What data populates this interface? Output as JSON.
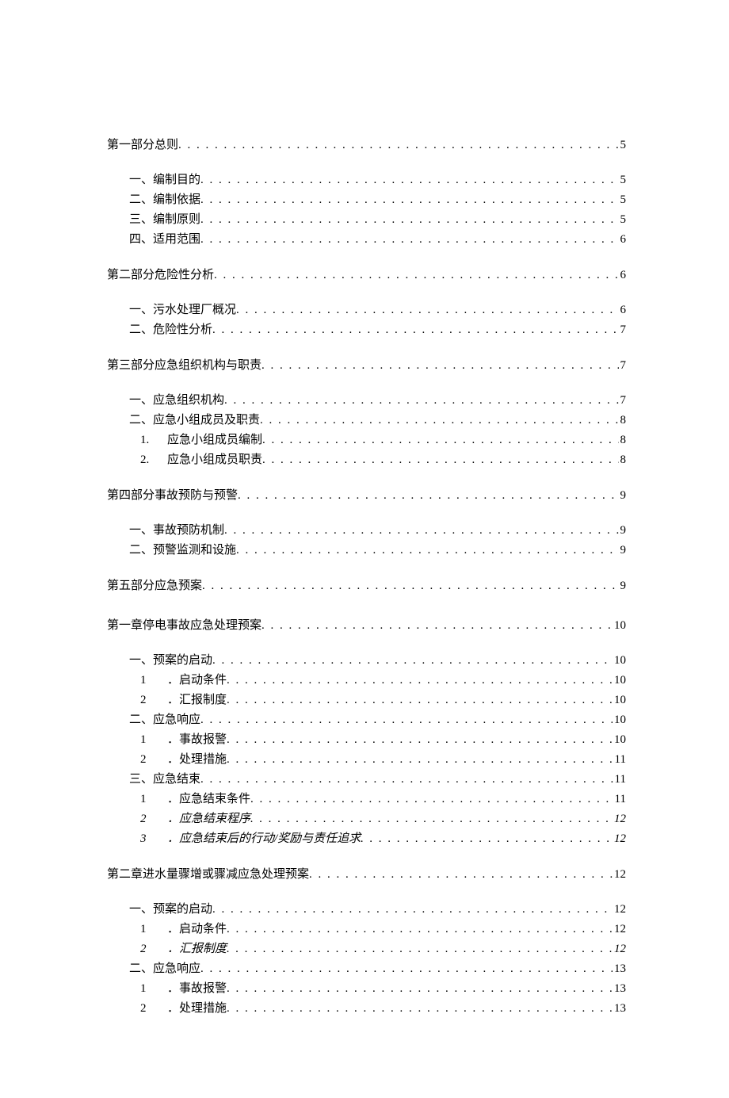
{
  "toc": [
    {
      "level": 1,
      "label": "第一部分总则",
      "page": "5"
    },
    {
      "spacer": true
    },
    {
      "level": 2,
      "label": "一、编制目的",
      "page": "5"
    },
    {
      "level": 2,
      "label": "二、编制依据",
      "page": "5"
    },
    {
      "level": 2,
      "label": "三、编制原则",
      "page": "5"
    },
    {
      "level": 2,
      "label": "四、适用范围",
      "page": "6"
    },
    {
      "spacer": true
    },
    {
      "level": 1,
      "label": "第二部分危险性分析",
      "page": "6"
    },
    {
      "spacer": true
    },
    {
      "level": 2,
      "label": "一、污水处理厂概况",
      "page": "6"
    },
    {
      "level": 2,
      "label": "二、危险性分析",
      "page": "7"
    },
    {
      "spacer": true
    },
    {
      "level": 1,
      "label": "第三部分应急组织机构与职责",
      "page": "7"
    },
    {
      "spacer": true
    },
    {
      "level": 2,
      "label": "一、应急组织机构",
      "page": "7"
    },
    {
      "level": 2,
      "label": "二、应急小组成员及职责",
      "page": "8"
    },
    {
      "level": 3,
      "num": "1.",
      "label": "应急小组成员编制",
      "page": "8"
    },
    {
      "level": 3,
      "num": "2.",
      "label": "应急小组成员职责",
      "page": "8"
    },
    {
      "spacer": true
    },
    {
      "level": 1,
      "label": "第四部分事故预防与预警",
      "page": "9"
    },
    {
      "spacer": true
    },
    {
      "level": 2,
      "label": "一、事故预防机制",
      "page": "9"
    },
    {
      "level": 2,
      "label": "二、预警监测和设施",
      "page": "9"
    },
    {
      "spacer": true
    },
    {
      "level": 1,
      "label": "第五部分应急预案",
      "page": "9"
    },
    {
      "spacer": true
    },
    {
      "level": 1,
      "label": "第一章停电事故应急处理预案",
      "page": "10"
    },
    {
      "spacer": true
    },
    {
      "level": 2,
      "label": "一、预案的启动",
      "page": "10"
    },
    {
      "level": 3,
      "num": "1",
      "label": "．启动条件",
      "page": "10"
    },
    {
      "level": 3,
      "num": "2",
      "label": "．汇报制度",
      "page": "10"
    },
    {
      "level": 2,
      "label": "二、应急响应",
      "page": "10"
    },
    {
      "level": 3,
      "num": "1",
      "label": "．事故报警",
      "page": "10"
    },
    {
      "level": 3,
      "num": "2",
      "label": "．处理措施",
      "page": "11"
    },
    {
      "level": 2,
      "label": "三、应急结束",
      "page": "11"
    },
    {
      "level": 3,
      "num": "1",
      "label": "．应急结束条件",
      "page": "11"
    },
    {
      "level": 3,
      "num": "2",
      "label": "．应急结束程序",
      "page": "12",
      "italic": true
    },
    {
      "level": 3,
      "num": "3",
      "label": "．应急结束后的行动/奖励与责任追求",
      "page": "12",
      "italic": true
    },
    {
      "spacer": true
    },
    {
      "level": 1,
      "label": "第二章进水量骤增或骤减应急处理预案",
      "page": "12"
    },
    {
      "spacer": true
    },
    {
      "level": 2,
      "label": "一、预案的启动",
      "page": "12"
    },
    {
      "level": 3,
      "num": "1",
      "label": "．启动条件",
      "page": "12"
    },
    {
      "level": 3,
      "num": "2",
      "label": "．汇报制度",
      "page": "12",
      "italic": true
    },
    {
      "level": 2,
      "label": "二、应急响应",
      "page": "13"
    },
    {
      "level": 3,
      "num": "1",
      "label": "．事故报警",
      "page": "13"
    },
    {
      "level": 3,
      "num": "2",
      "label": "．处理措施",
      "page": "13"
    }
  ]
}
